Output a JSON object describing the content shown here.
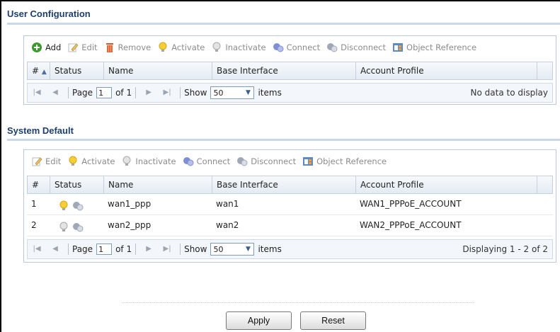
{
  "user_config": {
    "title": "User Configuration",
    "toolbar": {
      "add": "Add",
      "edit": "Edit",
      "remove": "Remove",
      "activate": "Activate",
      "inactivate": "Inactivate",
      "connect": "Connect",
      "disconnect": "Disconnect",
      "object_reference": "Object Reference"
    },
    "columns": {
      "num": "#",
      "status": "Status",
      "name": "Name",
      "base_interface": "Base Interface",
      "account_profile": "Account Profile"
    },
    "pager": {
      "page_label": "Page",
      "page_value": "1",
      "of_label": "of 1",
      "show_label": "Show",
      "show_value": "50",
      "items_label": "items",
      "summary": "No data to display"
    }
  },
  "system_default": {
    "title": "System Default",
    "toolbar": {
      "edit": "Edit",
      "activate": "Activate",
      "inactivate": "Inactivate",
      "connect": "Connect",
      "disconnect": "Disconnect",
      "object_reference": "Object Reference"
    },
    "columns": {
      "num": "#",
      "status": "Status",
      "name": "Name",
      "base_interface": "Base Interface",
      "account_profile": "Account Profile"
    },
    "rows": [
      {
        "num": "1",
        "active": true,
        "name": "wan1_ppp",
        "base_interface": "wan1",
        "account_profile": "WAN1_PPPoE_ACCOUNT"
      },
      {
        "num": "2",
        "active": false,
        "name": "wan2_ppp",
        "base_interface": "wan2",
        "account_profile": "WAN2_PPPoE_ACCOUNT"
      }
    ],
    "pager": {
      "page_label": "Page",
      "page_value": "1",
      "of_label": "of 1",
      "show_label": "Show",
      "show_value": "50",
      "items_label": "items",
      "summary": "Displaying 1 - 2 of 2"
    }
  },
  "buttons": {
    "apply": "Apply",
    "reset": "Reset"
  },
  "colors": {
    "title": "#1d3f6e",
    "section_rule": "#c9d7e8",
    "grid_border": "#c3d0df"
  }
}
